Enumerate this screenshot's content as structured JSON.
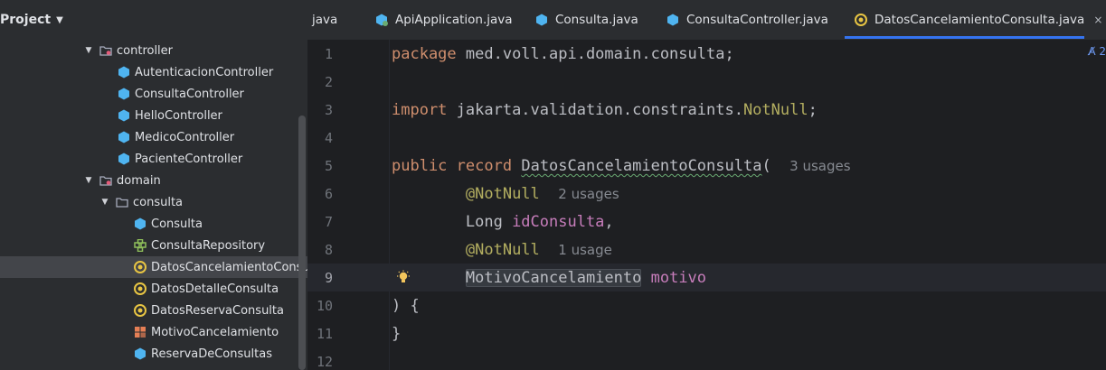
{
  "project_panel": {
    "title": "Project",
    "tree": [
      {
        "label": "controller",
        "type": "package-folder",
        "expanded": true
      },
      {
        "label": "AutenticacionController",
        "type": "class"
      },
      {
        "label": "ConsultaController",
        "type": "class"
      },
      {
        "label": "HelloController",
        "type": "class"
      },
      {
        "label": "MedicoController",
        "type": "class"
      },
      {
        "label": "PacienteController",
        "type": "class"
      },
      {
        "label": "domain",
        "type": "package-folder",
        "expanded": true
      },
      {
        "label": "consulta",
        "type": "folder",
        "expanded": true
      },
      {
        "label": "Consulta",
        "type": "class"
      },
      {
        "label": "ConsultaRepository",
        "type": "interface"
      },
      {
        "label": "DatosCancelamientoConsult",
        "type": "record",
        "selected": true
      },
      {
        "label": "DatosDetalleConsulta",
        "type": "record"
      },
      {
        "label": "DatosReservaConsulta",
        "type": "record"
      },
      {
        "label": "MotivoCancelamiento",
        "type": "enum"
      },
      {
        "label": "ReservaDeConsultas",
        "type": "class"
      }
    ]
  },
  "tabs": [
    {
      "label": "java",
      "icon": "none"
    },
    {
      "label": "ApiApplication.java",
      "icon": "spring-class-icon"
    },
    {
      "label": "Consulta.java",
      "icon": "class-icon"
    },
    {
      "label": "ConsultaController.java",
      "icon": "class-icon"
    },
    {
      "label": "DatosCancelamientoConsulta.java",
      "icon": "record-icon",
      "active": true,
      "close": "×"
    }
  ],
  "editor": {
    "reader_mode": "A̸ 2",
    "current_line": 9,
    "lines": [
      {
        "n": "1",
        "tokens": [
          {
            "t": "package",
            "c": "kw"
          },
          {
            "t": " med.voll.api.domain.consulta;"
          }
        ]
      },
      {
        "n": "2",
        "tokens": []
      },
      {
        "n": "3",
        "tokens": [
          {
            "t": "import",
            "c": "kw"
          },
          {
            "t": " jakarta.validation.constraints."
          },
          {
            "t": "NotNull",
            "c": "ann"
          },
          {
            "t": ";"
          }
        ]
      },
      {
        "n": "4",
        "tokens": []
      },
      {
        "n": "5",
        "tokens": [
          {
            "t": "public",
            "c": "kw"
          },
          {
            "t": " "
          },
          {
            "t": "record",
            "c": "kw"
          },
          {
            "t": " "
          },
          {
            "t": "DatosCancelamientoConsulta",
            "c": "type-wavy"
          },
          {
            "t": "(  "
          },
          {
            "t": "3 usages",
            "c": "hint"
          }
        ]
      },
      {
        "n": "6",
        "tokens": [
          {
            "t": "        "
          },
          {
            "t": "@NotNull",
            "c": "ann"
          },
          {
            "t": "  "
          },
          {
            "t": "2 usages",
            "c": "hint"
          }
        ]
      },
      {
        "n": "7",
        "tokens": [
          {
            "t": "        Long "
          },
          {
            "t": "idConsulta",
            "c": "fld"
          },
          {
            "t": ","
          }
        ]
      },
      {
        "n": "8",
        "tokens": [
          {
            "t": "        "
          },
          {
            "t": "@NotNull",
            "c": "ann"
          },
          {
            "t": "  "
          },
          {
            "t": "1 usage",
            "c": "hint"
          }
        ]
      },
      {
        "n": "9",
        "tokens": [
          {
            "t": "        "
          },
          {
            "t": "MotivoCancelamiento",
            "c": "hl-box"
          },
          {
            "t": " "
          },
          {
            "t": "motivo",
            "c": "fld"
          }
        ]
      },
      {
        "n": "10",
        "tokens": [
          {
            "t": ") {"
          }
        ]
      },
      {
        "n": "11",
        "tokens": [
          {
            "t": "}"
          }
        ]
      },
      {
        "n": "12",
        "tokens": []
      }
    ]
  },
  "colors": {
    "accent": "#3574f0",
    "class_icon": "#4fb4f0",
    "record_icon": "#e8c543",
    "enum_icon": "#e57f55",
    "interface_icon": "#8fbf5a"
  }
}
